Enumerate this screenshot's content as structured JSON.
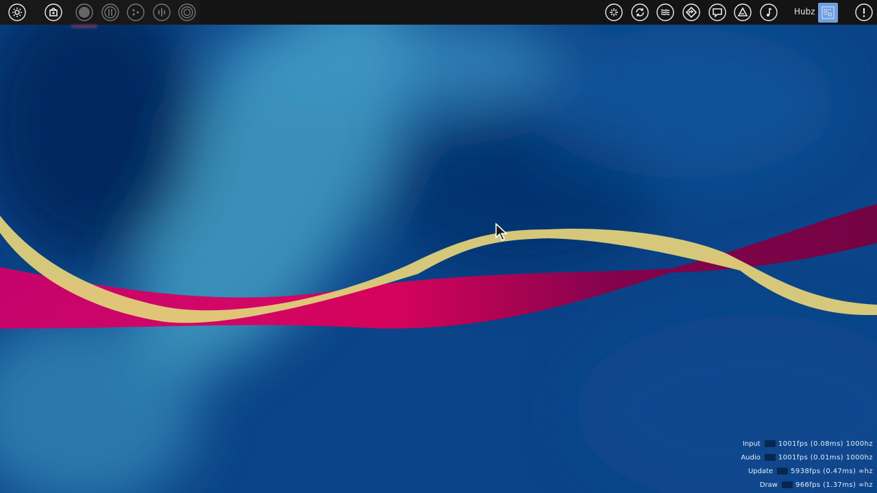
{
  "toolbar": {
    "left_buttons": [
      {
        "icon": "settings-icon"
      },
      {
        "icon": "home-icon"
      },
      {
        "icon": "record-icon",
        "active": true
      },
      {
        "icon": "pause-icon"
      },
      {
        "icon": "dots-icon"
      },
      {
        "icon": "equalizer-icon"
      },
      {
        "icon": "target-icon"
      }
    ],
    "right_buttons": [
      {
        "icon": "sparkle-icon"
      },
      {
        "icon": "sync-icon"
      },
      {
        "icon": "waves-icon"
      },
      {
        "icon": "diamond-arrow-icon"
      },
      {
        "icon": "chat-icon"
      },
      {
        "icon": "triangle-icon"
      },
      {
        "icon": "music-note-icon"
      }
    ],
    "username": "Hubz",
    "notification_icon": "alert-icon",
    "accent_color": "#6f9fe0"
  },
  "stats": {
    "input": {
      "label": "Input",
      "value": "1001fps (0.08ms) 1000hz"
    },
    "audio": {
      "label": "Audio",
      "value": "1001fps (0.01ms) 1000hz"
    },
    "update": {
      "label": "Update",
      "value": "5938fps (0.47ms) ∞hz"
    },
    "draw": {
      "label": "Draw",
      "value": "966fps (1.37ms) ∞hz"
    }
  },
  "visualizer": {
    "ribbon_colors": [
      "#e6d47a",
      "#c8005f",
      "#7a0040"
    ],
    "background_colors": [
      "#0a3a78",
      "#2e86b8",
      "#062a5a"
    ]
  }
}
